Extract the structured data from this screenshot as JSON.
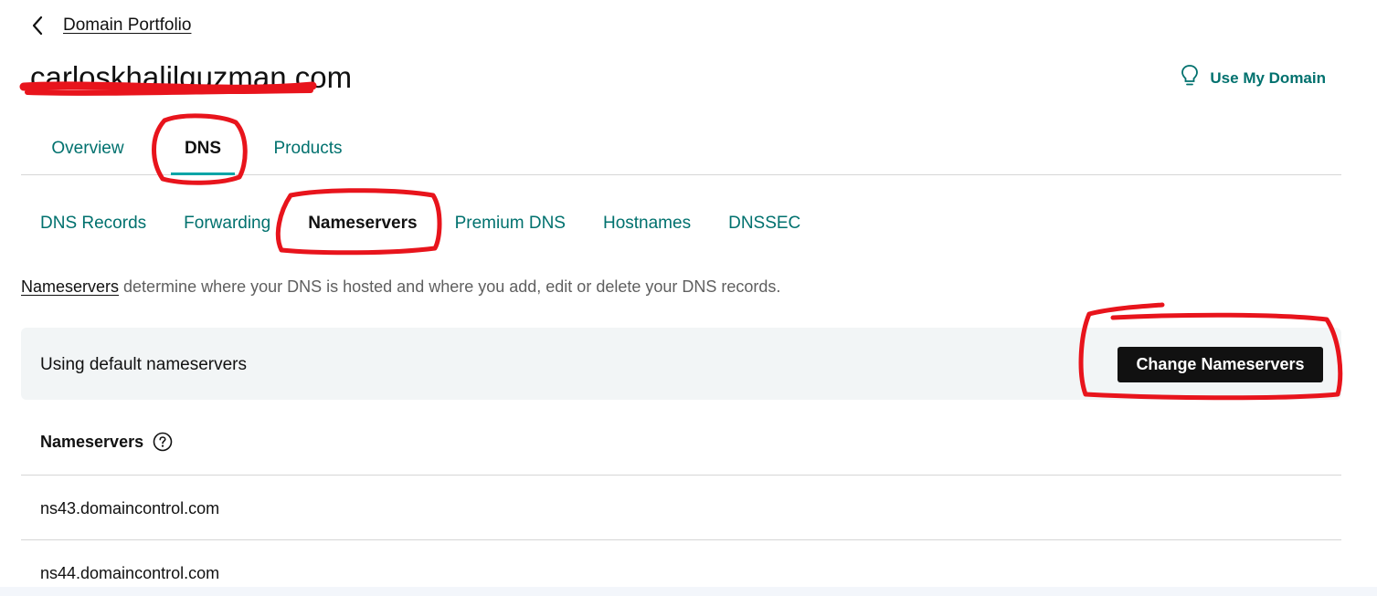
{
  "header": {
    "back_link": "Domain Portfolio",
    "domain_title": "carloskhalilguzman.com",
    "use_my_domain": "Use My Domain"
  },
  "main_tabs": [
    {
      "label": "Overview",
      "active": false
    },
    {
      "label": "DNS",
      "active": true
    },
    {
      "label": "Products",
      "active": false
    }
  ],
  "sub_tabs": [
    {
      "label": "DNS Records",
      "active": false
    },
    {
      "label": "Forwarding",
      "active": false
    },
    {
      "label": "Nameservers",
      "active": true
    },
    {
      "label": "Premium DNS",
      "active": false
    },
    {
      "label": "Hostnames",
      "active": false
    },
    {
      "label": "DNSSEC",
      "active": false
    }
  ],
  "description": {
    "link": "Nameservers",
    "text": " determine where your DNS is hosted and where you add, edit or delete your DNS records."
  },
  "status_box": {
    "text": "Using default nameservers",
    "button": "Change Nameservers"
  },
  "nameservers": {
    "header": "Nameservers",
    "items": [
      "ns43.domaincontrol.com",
      "ns44.domaincontrol.com"
    ]
  },
  "colors": {
    "accent_teal": "#00716e",
    "active_underline": "#00a4a6",
    "annotation_red": "#e8141c",
    "button_bg": "#111111"
  }
}
